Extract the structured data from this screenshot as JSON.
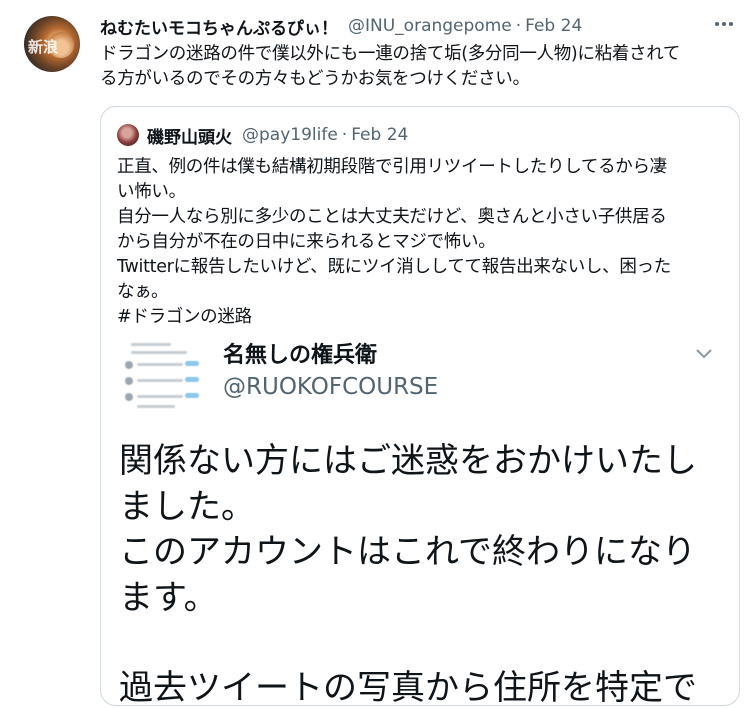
{
  "tweet": {
    "name": "ねむたいモコちゃんぷるぴぃ！",
    "handle": "@INU_orangepome",
    "dot": "·",
    "date": "Feb 24",
    "more_icon": "more-horizontal-icon",
    "avatar_watermark": "新浪",
    "text_line1": "ドラゴンの迷路の件で僕以外にも一連の捨て垢(多分同一人物)に粘着されて",
    "text_line2": "る方がいるのでその方々もどうかお気をつけください。"
  },
  "quote": {
    "name": "磯野山頭火",
    "handle": "@pay19life",
    "dot": "·",
    "date": "Feb 24",
    "lines": [
      "正直、例の件は僕も結構初期段階で引用リツイートしたりしてるから凄",
      "い怖い。",
      "自分一人なら別に多少のことは大丈夫だけど、奥さんと小さい子供居る",
      "から自分が不在の日中に来られるとマジで怖い。",
      "Twitterに報告したいけど、既にツイ消ししてて報告出来ないし、困った",
      "なぁ。",
      "#ドラゴンの迷路"
    ],
    "media": {
      "name": "名無しの権兵衛",
      "handle": "@RUOKOFCOURSE",
      "chevron_icon": "chevron-down-icon",
      "big_text": [
        "関係ない方にはご迷惑をおかけいたし",
        "ました。",
        "このアカウントはこれで終わりになり",
        "ます。",
        "",
        "過去ツイートの写真から住所を特定で"
      ]
    }
  }
}
